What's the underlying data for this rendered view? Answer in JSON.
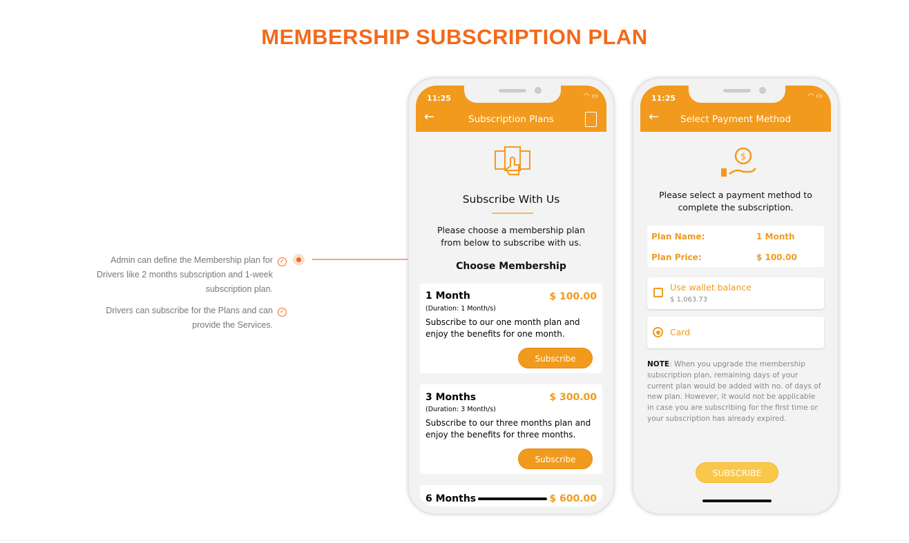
{
  "page": {
    "title": "MEMBERSHIP SUBSCRIPTION PLAN"
  },
  "features": [
    {
      "text_lines": [
        "Admin can define the Membership plan for",
        "Drivers like 2 months subscription and 1-week",
        "subscription plan."
      ]
    },
    {
      "text_lines": [
        "Drivers can subscribe for the Plans and can",
        "provide the Services."
      ]
    }
  ],
  "colors": {
    "accent": "#f26a1b",
    "app_orange": "#f19a1e"
  },
  "phone1": {
    "time": "11:25",
    "header_title": "Subscription Plans",
    "heading": "Subscribe With Us",
    "intro_lines": [
      "Please choose a membership plan",
      "from below to subscribe with us."
    ],
    "section_title": "Choose Membership",
    "plans": [
      {
        "name": "1 Month",
        "price": "$ 100.00",
        "duration": "(Duration: 1 Month/s)",
        "desc_lines": [
          "Subscribe to our one month plan and",
          "enjoy the benefits for one month."
        ],
        "button": "Subscribe"
      },
      {
        "name": "3 Months",
        "price": "$ 300.00",
        "duration": "(Duration: 3 Month/s)",
        "desc_lines": [
          "Subscribe to our three months plan and",
          "enjoy the benefits for three months."
        ],
        "button": "Subscribe"
      },
      {
        "name": "6 Months",
        "price": "$ 600.00"
      }
    ]
  },
  "phone2": {
    "time": "11:25",
    "header_title": "Select Payment Method",
    "intro_lines": [
      "Please select a payment method to",
      "complete the subscription."
    ],
    "plan_name_label": "Plan Name:",
    "plan_name": "1 Month",
    "plan_price_label": "Plan Price:",
    "plan_price": "$ 100.00",
    "wallet_label": "Use wallet balance",
    "wallet_balance": "$ 1,063.73",
    "wallet_checked": false,
    "card_label": "Card",
    "card_selected": true,
    "note_label": "NOTE",
    "note_text": ": When you upgrade the membership subscription plan, remaining days of your current plan would be added with no. of days of new plan. However, it would not be applicable in case you are subscribing for the first time or your subscription has already expired.",
    "subscribe_button": "SUBSCRIBE"
  }
}
